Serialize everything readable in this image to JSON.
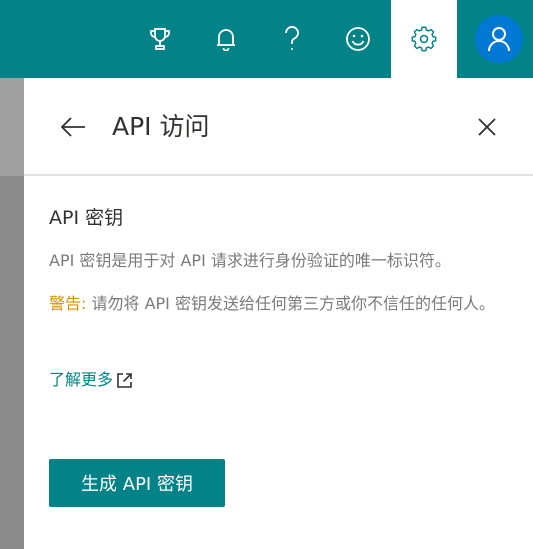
{
  "topbar": {
    "icons": [
      "trophy-icon",
      "bell-icon",
      "help-icon",
      "smiley-icon",
      "gear-icon",
      "person-icon"
    ],
    "background": "#038387",
    "avatar_color": "#0078d4"
  },
  "panel": {
    "title": "API 访问",
    "back_icon": "arrow-left-icon",
    "close_icon": "close-icon",
    "section_title": "API 密钥",
    "description": "API 密钥是用于对 API 请求进行身份验证的唯一标识符。",
    "warning_label": "警告:",
    "warning_text": " 请勿将 API 密钥发送给任何第三方或你不信任的任何人。",
    "learn_more": "了解更多",
    "learn_more_icon": "external-link-icon",
    "primary_button": "生成 API 密钥",
    "accent_color": "#038387",
    "warning_color": "#d29200"
  }
}
